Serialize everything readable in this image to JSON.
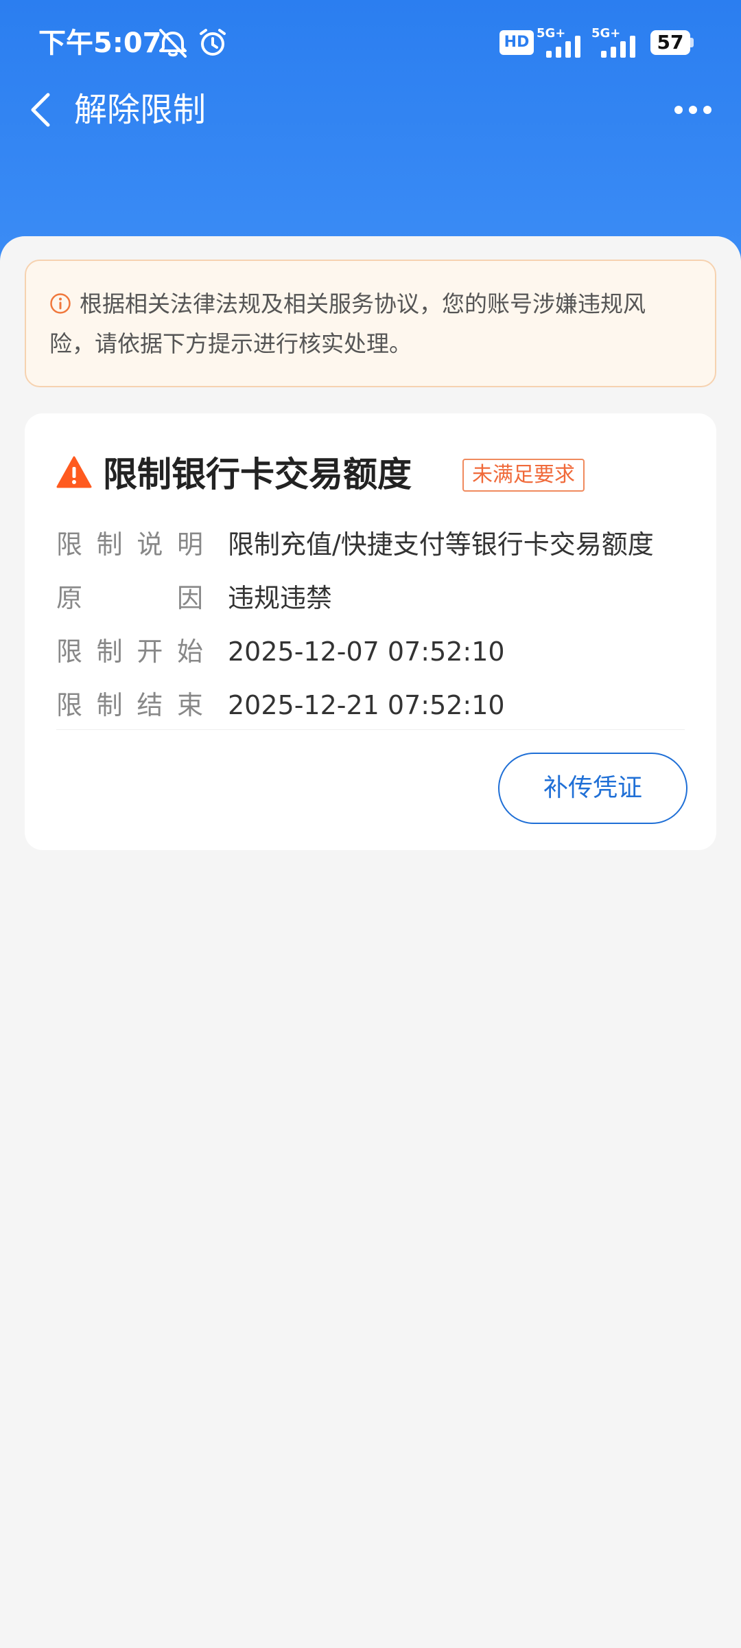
{
  "status_bar": {
    "time": "下午5:07",
    "battery": "57",
    "network_badge": "HD",
    "network_label_1": "5G+",
    "network_label_2": "5G+"
  },
  "app_bar": {
    "title": "解除限制"
  },
  "notice": {
    "text": "根据相关法律法规及相关服务协议，您的账号涉嫌违规风险，请依据下方提示进行核实处理。"
  },
  "card": {
    "title": "限制银行卡交易额度",
    "status_badge": "未满足要求",
    "rows": [
      {
        "label": [
          "限",
          "制",
          "说",
          "明"
        ],
        "value": "限制充值/快捷支付等银行卡交易额度"
      },
      {
        "label": [
          "原",
          "因"
        ],
        "value": "违规违禁"
      },
      {
        "label": [
          "限",
          "制",
          "开",
          "始"
        ],
        "value": "2025-12-07 07:52:10"
      },
      {
        "label": [
          "限",
          "制",
          "结",
          "束"
        ],
        "value": "2025-12-21 07:52:10"
      }
    ],
    "upload_button": "补传凭证"
  },
  "colors": {
    "header_blue": "#2b7ef0",
    "warning_orange": "#ff5a1f",
    "badge_orange": "#f06a3a",
    "link_blue": "#1f6fd6",
    "notice_bg": "#fef7ee"
  },
  "icons": [
    "back-icon",
    "more-icon",
    "info-icon",
    "warning-icon",
    "mute-icon",
    "alarm-icon",
    "signal-icon",
    "battery-icon"
  ]
}
